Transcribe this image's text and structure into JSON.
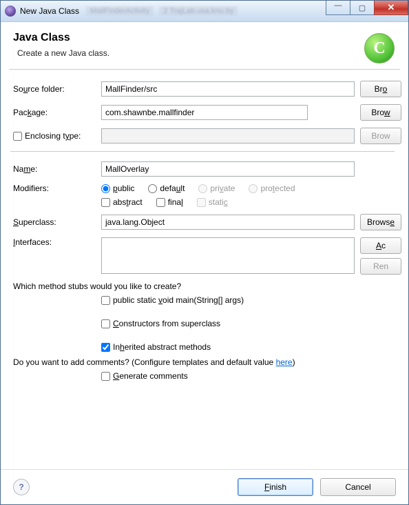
{
  "titlebar": {
    "title": "New Java Class",
    "blurred1": "MailFinderActivity",
    "blurred2": "2  TrajLab.usa.knu.by"
  },
  "header": {
    "heading": "Java Class",
    "subtitle": "Create a new Java class.",
    "icon_letter": "C"
  },
  "fields": {
    "source_folder_label_pre": "So",
    "source_folder_label_u": "u",
    "source_folder_label_post": "rce folder:",
    "source_folder_value": "MallFinder/src",
    "package_label_pre": "Pac",
    "package_label_u": "k",
    "package_label_post": "age:",
    "package_value": "com.shawnbe.mallfinder",
    "enclosing_label_pre": "Enclosing t",
    "enclosing_label_u": "y",
    "enclosing_label_post": "pe:",
    "enclosing_value": "",
    "name_label_pre": "Na",
    "name_label_u": "m",
    "name_label_post": "e:",
    "name_value": "MallOverlay",
    "modifiers_label": "Modifiers:",
    "superclass_label_u": "S",
    "superclass_label_post": "uperclass:",
    "superclass_value": "java.lang.Object",
    "interfaces_label_u": "I",
    "interfaces_label_post": "nterfaces:",
    "interfaces_value": ""
  },
  "modifiers": {
    "public_u": "p",
    "public_post": "ublic",
    "default_pre": "defa",
    "default_u": "u",
    "default_post": "lt",
    "private_pre": "pri",
    "private_u": "v",
    "private_post": "ate",
    "protected_pre": "pro",
    "protected_u": "t",
    "protected_post": "ected",
    "abstract_pre": "abs",
    "abstract_u": "t",
    "abstract_post": "ract",
    "final_pre": "fina",
    "final_u": "l",
    "static": "stati",
    "static_u": "c"
  },
  "stubs": {
    "question": "Which method stubs would you like to create?",
    "main_pre": "public static ",
    "main_u": "v",
    "main_post": "oid main(String[] args)",
    "constructors_u": "C",
    "constructors_post": "onstructors from superclass",
    "inherited_pre": "In",
    "inherited_u": "h",
    "inherited_post": "erited abstract methods"
  },
  "comments": {
    "question_pre": "Do you want to add comments? (Configure templates and default value ",
    "link": "here",
    "question_post": ")",
    "gen_u": "G",
    "gen_post": "enerate comments"
  },
  "buttons": {
    "browse_pre": "Br",
    "browse_u": "o",
    "browse2_pre": "Bro",
    "browse2_u": "w",
    "browse3_pre": "Brows",
    "browse3_u": "e",
    "browse4_pre": "Brow",
    "add_u": "A",
    "add_post": "c",
    "remove_pre": "Re",
    "remove_post": "n",
    "finish_u": "F",
    "finish_post": "inish",
    "cancel": "Cancel"
  }
}
